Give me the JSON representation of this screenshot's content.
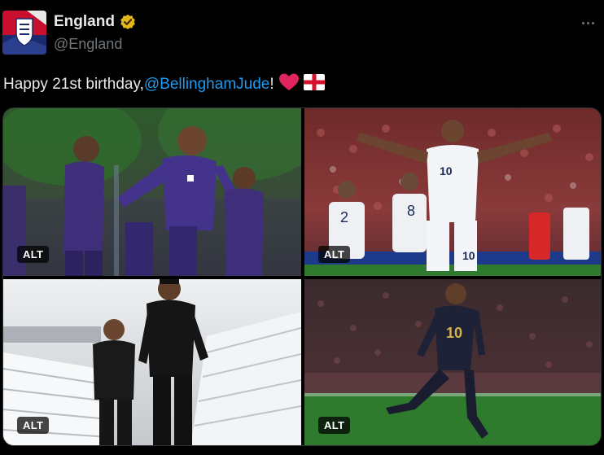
{
  "account": {
    "name": "England",
    "handle": "@England"
  },
  "tweet": {
    "text_before": "Happy 21st birthday, ",
    "mention": "@BellinghamJude",
    "text_after": "!"
  },
  "media": {
    "alt_label": "ALT",
    "items": [
      {
        "jersey_number": ""
      },
      {
        "jersey_number": "10"
      },
      {
        "jersey_number": ""
      },
      {
        "jersey_number": "10"
      }
    ]
  },
  "colors": {
    "background": "#000000",
    "text": "#e7e9ea",
    "muted": "#71767b",
    "link": "#1d9bf0",
    "verified_gold": "#e2b719",
    "heart": "#f91880"
  },
  "icons": [
    "verified-badge-icon",
    "more-icon",
    "heart-emoji-icon",
    "england-flag-emoji-icon"
  ]
}
